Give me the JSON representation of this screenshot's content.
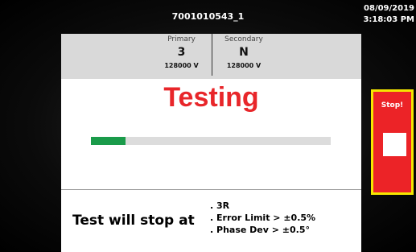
{
  "header": {
    "device_id": "7001010543_1",
    "date": "08/09/2019",
    "time": "3:18:03 PM"
  },
  "ratio": {
    "primary_label": "Primary",
    "primary_value": "3",
    "primary_voltage": "128000 V",
    "secondary_label": "Secondary",
    "secondary_value": "N",
    "secondary_voltage": "128000 V"
  },
  "status": {
    "text": "Testing",
    "progress_fraction": 0.145
  },
  "stop_conditions": {
    "title": "Test will stop at",
    "items": [
      ". 3R",
      ". Error Limit > ±0.5%",
      ". Phase Dev > ±0.5°"
    ]
  },
  "stop_button": {
    "label": "Stop!"
  },
  "colors": {
    "status_red": "#e8262a",
    "progress_green": "#1a9b4a",
    "stop_button_red": "#ec2327",
    "stop_button_border": "#f5e600"
  }
}
